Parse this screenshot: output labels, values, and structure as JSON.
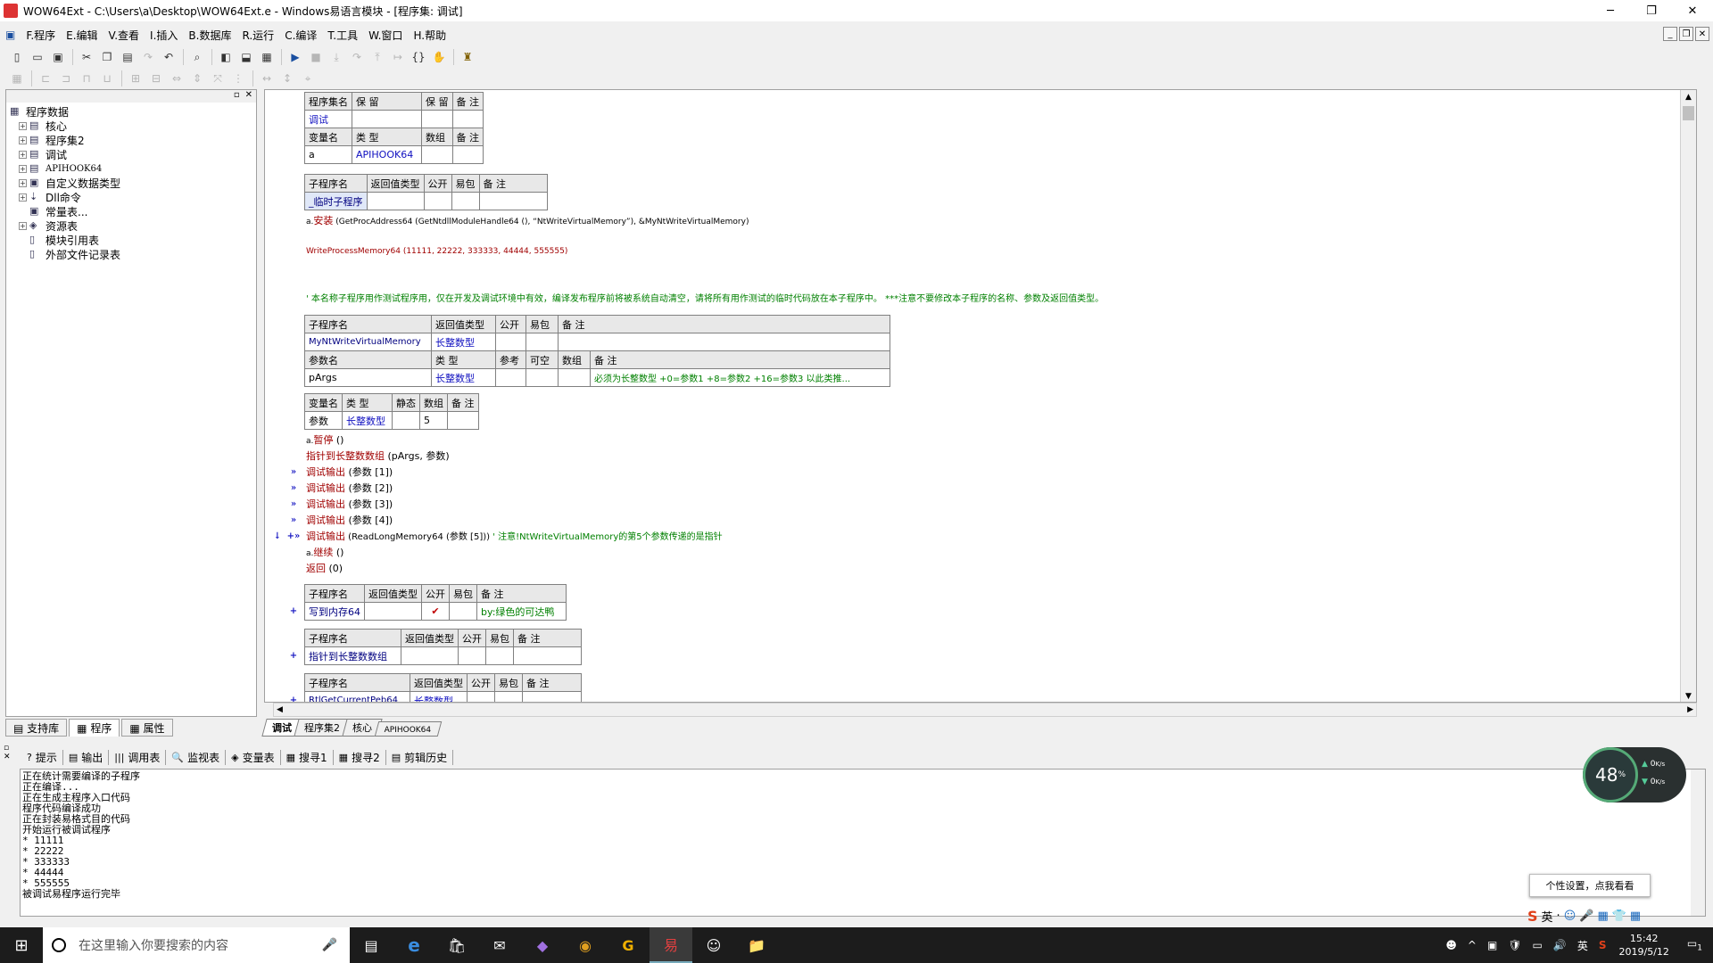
{
  "window": {
    "title": "WOW64Ext - C:\\Users\\a\\Desktop\\WOW64Ext.e - Windows易语言模块 - [程序集: 调试]",
    "controls": [
      "─",
      "❐",
      "✕"
    ]
  },
  "menu": {
    "items": [
      "F.程序",
      "E.编辑",
      "V.查看",
      "I.插入",
      "B.数据库",
      "R.运行",
      "C.编译",
      "T.工具",
      "W.窗口",
      "H.帮助"
    ],
    "mdi_controls": [
      "_",
      "❐",
      "✕"
    ]
  },
  "left_panel": {
    "header_controls": [
      "▫",
      "✕"
    ],
    "root": "程序数据",
    "nodes": [
      "核心",
      "程序集2",
      "调试",
      "APIHOOK64",
      "自定义数据类型",
      "Dll命令",
      "常量表...",
      "资源表"
    ],
    "children": [
      "模块引用表",
      "外部文件记录表"
    ],
    "tabs": [
      "支持库",
      "程序",
      "属性"
    ]
  },
  "editor": {
    "assembly_table": {
      "header": [
        "程序集名",
        "保 留",
        "保 留",
        "备 注"
      ],
      "row": [
        "调试",
        "",
        "",
        ""
      ],
      "var_header": [
        "变量名",
        "类 型",
        "数组",
        "备 注"
      ],
      "var_row": [
        "a",
        "APIHOOK64",
        "",
        ""
      ]
    },
    "temp_sub": {
      "header": [
        "子程序名",
        "返回值类型",
        "公开",
        "易包",
        "备 注"
      ],
      "row": [
        "_临时子程序",
        "",
        "",
        "",
        ""
      ]
    },
    "lines": {
      "l1_a": "a.",
      "l1_b": "安装",
      "l1_c": " (GetProcAddress64 (GetNtdllModuleHandle64 (), “NtWriteVirtualMemory”), &MyNtWriteVirtualMemory)",
      "l2": "WriteProcessMemory64 (11111, 22222, 333333, 44444, 555555)",
      "l3": "' 本名称子程序用作测试程序用，仅在开发及调试环境中有效，编译发布程序前将被系统自动清空，请将所有用作测试的临时代码放在本子程序中。 ***注意不要修改本子程序的名称、参数及返回值类型。"
    },
    "my_sub": {
      "header": [
        "子程序名",
        "返回值类型",
        "公开",
        "易包",
        "备 注"
      ],
      "row": [
        "MyNtWriteVirtualMemory",
        "长整数型",
        "",
        "",
        ""
      ],
      "param_header": [
        "参数名",
        "类 型",
        "参考",
        "可空",
        "数组",
        "备 注"
      ],
      "param_row": [
        "pArgs",
        "长整数型",
        "",
        "",
        "",
        "必须为长整数型 +0=参数1 +8=参数2 +16=参数3 以此类推..."
      ]
    },
    "local_vars": {
      "header": [
        "变量名",
        "类 型",
        "静态",
        "数组",
        "备 注"
      ],
      "row": [
        "参数",
        "长整数型",
        "",
        "5",
        ""
      ]
    },
    "code": {
      "c1_a": "a.",
      "c1_b": "暂停",
      "c1_c": " ()",
      "c2_a": "指针到长整数数组",
      "c2_b": " (pArgs, 参数)",
      "d1_a": "调试输出",
      "d1_b": " (参数 [1])",
      "d2_a": "调试输出",
      "d2_b": " (参数 [2])",
      "d3_a": "调试输出",
      "d3_b": " (参数 [3])",
      "d4_a": "调试输出",
      "d4_b": " (参数 [4])",
      "d5_a": "调试输出",
      "d5_b": " (ReadLongMemory64 (参数 [5]))",
      "d5_c": "  ' 注意!NtWriteVirtualMemory的第5个参数传递的是指针",
      "c3_a": "a.",
      "c3_b": "继续",
      "c3_c": " ()",
      "c4_a": "返回",
      "c4_b": " (0)",
      "gutter_mark": "»",
      "gutter_arrow": "↓",
      "gutter_plus": "+",
      "gutter_plusmark": "+»"
    },
    "sub_write": {
      "header": [
        "子程序名",
        "返回值类型",
        "公开",
        "易包",
        "备 注"
      ],
      "row": [
        "写到内存64",
        "",
        "✔",
        "",
        "by:绿色的可达鸭"
      ]
    },
    "sub_ptr": {
      "header": [
        "子程序名",
        "返回值类型",
        "公开",
        "易包",
        "备 注"
      ],
      "row": [
        "指针到长整数数组",
        "",
        "",
        "",
        ""
      ]
    },
    "sub_peb": {
      "header": [
        "子程序名",
        "返回值类型",
        "公开",
        "易包",
        "备 注"
      ],
      "row": [
        "RtlGetCurrentPeb64",
        "长整数型",
        "",
        "",
        ""
      ]
    },
    "tabs": [
      "调试",
      "程序集2",
      "核心",
      "APIHOOK64"
    ]
  },
  "output_panel": {
    "tabs": [
      "提示",
      "输出",
      "调用表",
      "监视表",
      "变量表",
      "搜寻1",
      "搜寻2",
      "剪辑历史"
    ],
    "tab_icons": [
      "?",
      "▤",
      "|||",
      "🔍",
      "◈",
      "▦",
      "▦",
      "▤"
    ],
    "lines": [
      "正在统计需要编译的子程序",
      "正在编译...",
      "正在生成主程序入口代码",
      "程序代码编译成功",
      "正在封装易格式目的代码",
      "开始运行被调试程序",
      "* 11111",
      "* 22222",
      "* 333333",
      "* 44444",
      "* 555555",
      "被调试易程序运行完毕"
    ]
  },
  "widget": {
    "percent": "48",
    "percent_unit": "%",
    "up": "0",
    "down": "0",
    "unit": "K/s",
    "tooltip": "个性设置，点我看看"
  },
  "ime": {
    "lang": "英",
    "icons": [
      "S",
      "英",
      "·",
      "☺",
      "🎤",
      "▦",
      "👕",
      "▦"
    ]
  },
  "taskbar": {
    "search_placeholder": "在这里输入你要搜索的内容",
    "apps": [
      "▤",
      "e",
      "🛍",
      "✉",
      "◆",
      "◉",
      "G",
      "易",
      "☺",
      "📁"
    ],
    "tray": [
      "☻",
      "^",
      "▣",
      "🛡",
      "▭",
      "🔊",
      "英",
      "S"
    ],
    "time": "15:42",
    "date": "2019/5/12",
    "notification": "1"
  }
}
